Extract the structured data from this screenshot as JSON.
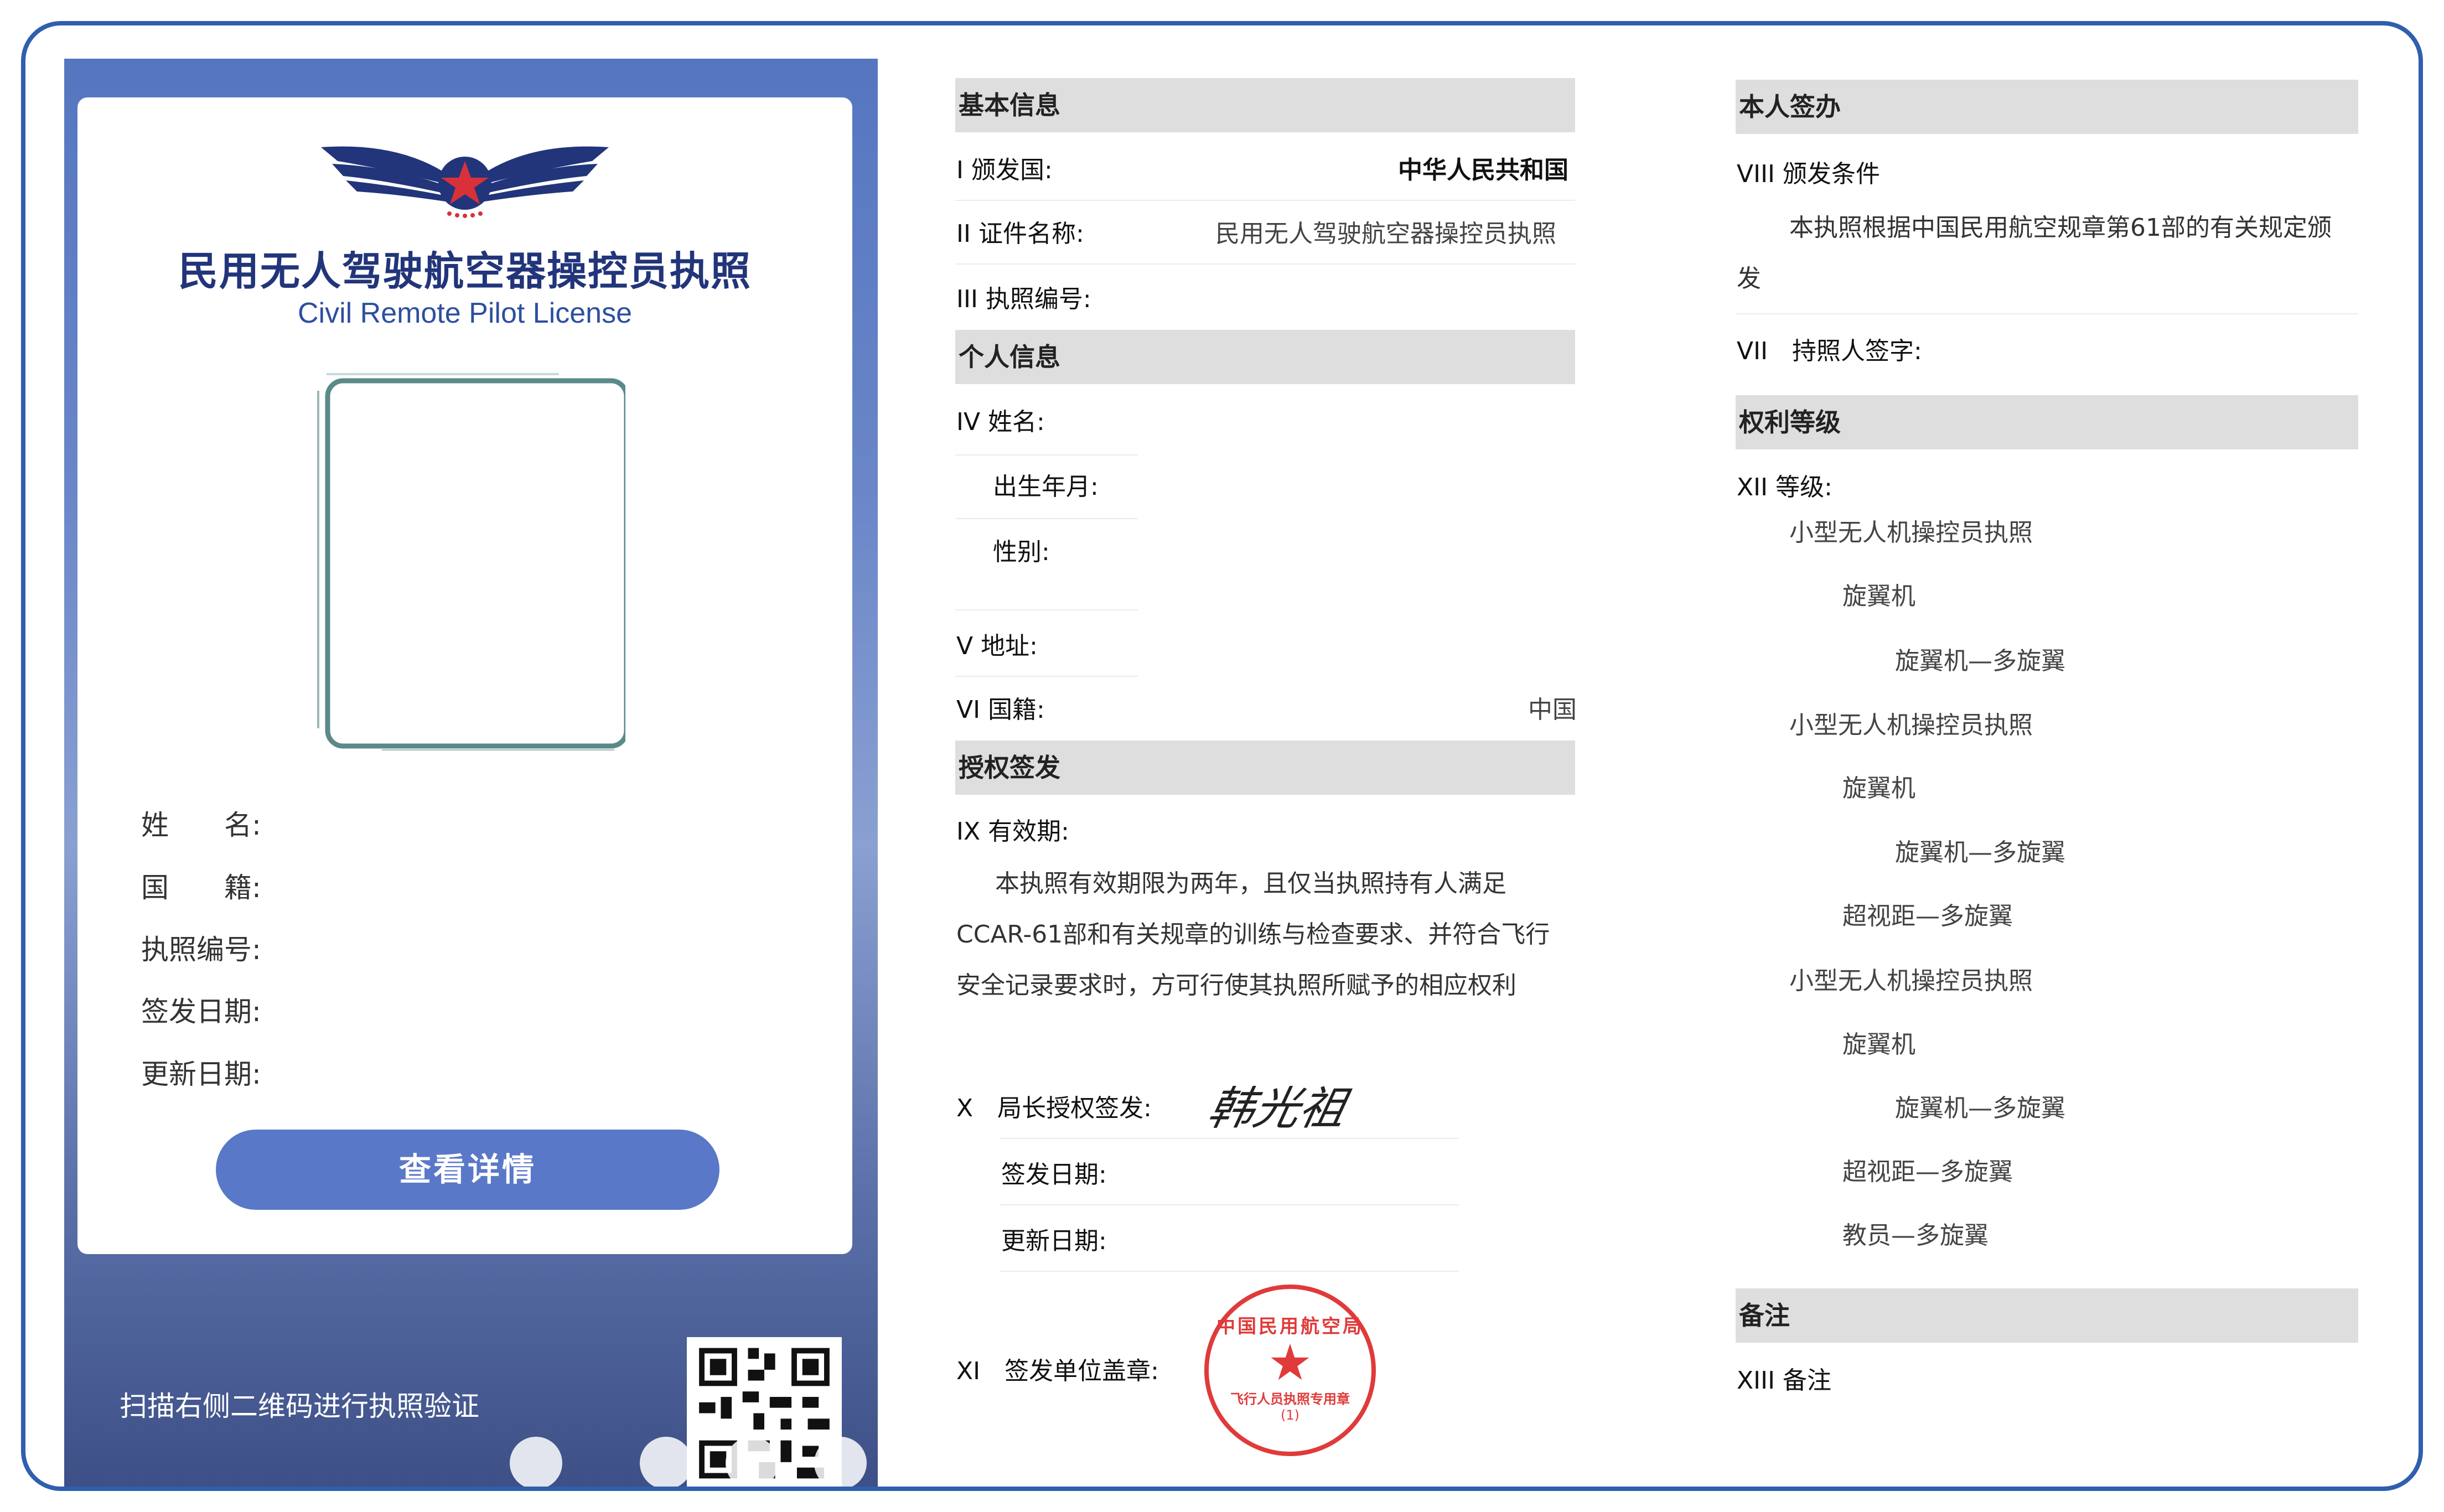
{
  "card": {
    "title_cn": "民用无人驾驶航空器操控员执照",
    "title_en": "Civil Remote Pilot License",
    "fields": [
      "姓　　名:",
      "国　　籍:",
      "执照编号:",
      "签发日期:",
      "更新日期:"
    ],
    "view_button": "查看详情",
    "scan_hint": "扫描右侧二维码进行执照验证"
  },
  "basic": {
    "header": "基本信息",
    "issuing_country_label": "I 颁发国:",
    "issuing_country_value": "中华人民共和国",
    "cert_name_label": "II 证件名称:",
    "cert_name_value": "民用无人驾驶航空器操控员执照",
    "license_no_label": "III 执照编号:"
  },
  "personal": {
    "header": "个人信息",
    "name_label": "IV 姓名:",
    "birth_label": "出生年月:",
    "gender_label": "性别:",
    "address_label": "V 地址:",
    "nationality_label": "VI 国籍:",
    "nationality_value": "中国"
  },
  "authorization": {
    "header": "授权签发",
    "validity_label": "IX 有效期:",
    "validity_text": "本执照有效期限为两年，且仅当执照持有人满足CCAR-61部和有关规章的训练与检查要求、并符合飞行安全记录要求时，方可行使其执照所赋予的相应权利",
    "director_label": "X　局长授权签发:",
    "signature": "韩光祖",
    "issue_date_label": "签发日期:",
    "renew_date_label": "更新日期:",
    "seal_label": "XI　签发单位盖章:",
    "seal_text_outer": "中国民用航空局",
    "seal_text_inner": "飞行人员执照专用章",
    "seal_number": "(1)"
  },
  "holder": {
    "header": "本人签办",
    "conditions_label": "VIII 颁发条件",
    "conditions_text": "本执照根据中国民用航空规章第61部的有关规定颁发",
    "signature_label": "VII　持照人签字:"
  },
  "rights": {
    "header": "权利等级",
    "level_label": "XII 等级:",
    "levels": [
      "小型无人机操控员执照",
      "旋翼机",
      "旋翼机—多旋翼",
      "小型无人机操控员执照",
      "旋翼机",
      "旋翼机—多旋翼",
      "超视距—多旋翼",
      "小型无人机操控员执照",
      "旋翼机",
      "旋翼机—多旋翼",
      "超视距—多旋翼",
      "教员—多旋翼"
    ]
  },
  "remarks": {
    "header": "备注",
    "label": "XIII 备注"
  },
  "colors": {
    "frame": "#2f5fae",
    "card_title": "#22357a",
    "button": "#5a78c8",
    "seal": "#e03a3a"
  }
}
